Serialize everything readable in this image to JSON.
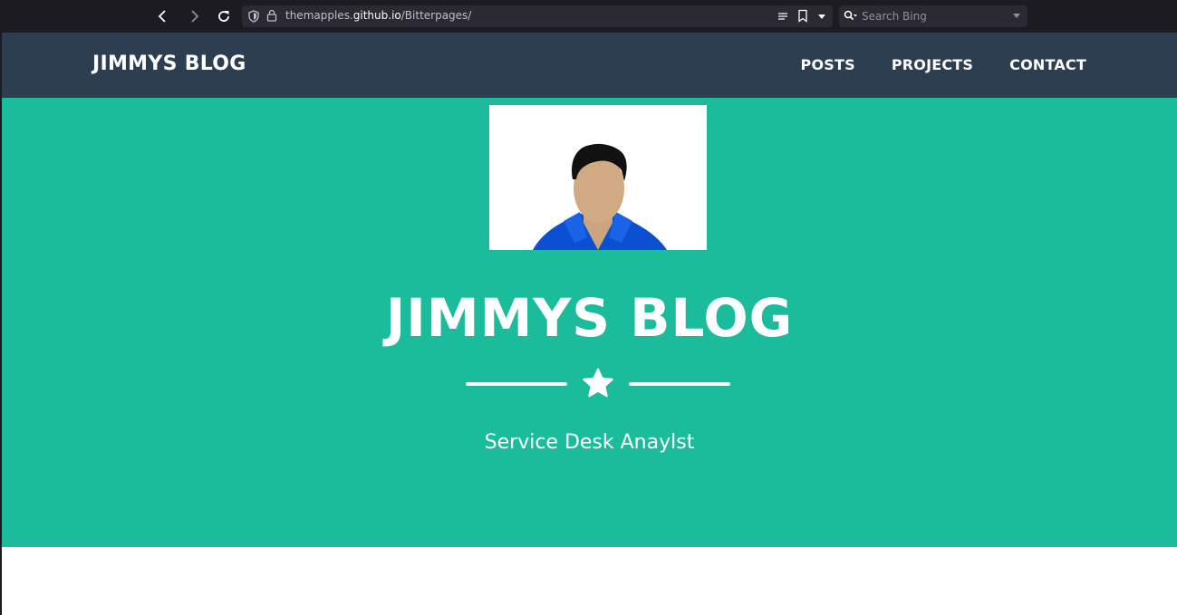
{
  "browser": {
    "url_prefix": "themapples.",
    "url_domain": "github.io",
    "url_path": "/Bitterpages/",
    "search_placeholder": "Search Bing"
  },
  "site": {
    "brand": "JIMMYS BLOG",
    "nav": [
      "POSTS",
      "PROJECTS",
      "CONTACT"
    ]
  },
  "masthead": {
    "title": "JIMMYS BLOG",
    "subtitle": "Service Desk Anaylst"
  },
  "colors": {
    "navbar": "#2c3e50",
    "masthead": "#1abc9c",
    "text": "#ffffff"
  }
}
